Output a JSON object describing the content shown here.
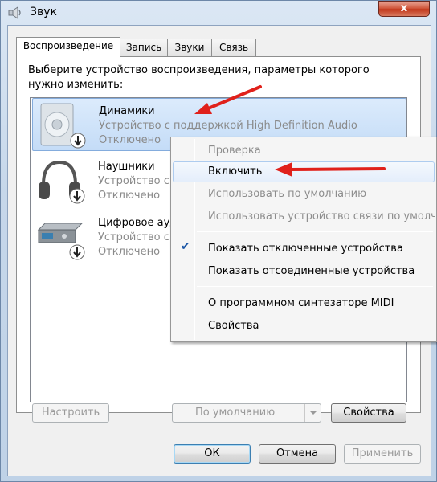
{
  "window": {
    "title": "Звук",
    "close_label": "x"
  },
  "tabs": [
    {
      "label": "Воспроизведение",
      "active": true
    },
    {
      "label": "Запись",
      "active": false
    },
    {
      "label": "Звуки",
      "active": false
    },
    {
      "label": "Связь",
      "active": false
    }
  ],
  "instruction": "Выберите устройство воспроизведения, параметры которого нужно изменить:",
  "devices": [
    {
      "name": "Динамики",
      "description": "Устройство с поддержкой High Definition Audio",
      "status": "Отключено",
      "icon": "speaker-icon"
    },
    {
      "name": "Наушники",
      "description": "Устройство с",
      "status": "Отключено",
      "icon": "headphones-icon"
    },
    {
      "name": "Цифровое аудио",
      "description": "Устройство с",
      "status": "Отключено",
      "icon": "digital-audio-icon"
    }
  ],
  "context_menu": {
    "items": [
      {
        "label": "Проверка",
        "disabled": true
      },
      {
        "label": "Включить",
        "disabled": false
      },
      {
        "label": "Использовать по умолчанию",
        "disabled": true
      },
      {
        "label": "Использовать устройство связи по умолчанию",
        "disabled": true
      },
      {
        "label": "Показать отключенные устройства",
        "checked": true
      },
      {
        "label": "Показать отсоединенные устройства"
      },
      {
        "label": "О программном синтезаторе MIDI"
      },
      {
        "label": "Свойства"
      }
    ]
  },
  "buttons": {
    "configure": "Настроить",
    "default": "По умолчанию",
    "properties": "Свойства",
    "ok": "ОК",
    "cancel": "Отмена",
    "apply": "Применить"
  },
  "colors": {
    "selection": "#c4dcf7",
    "annotation_arrow": "#e0211b"
  }
}
